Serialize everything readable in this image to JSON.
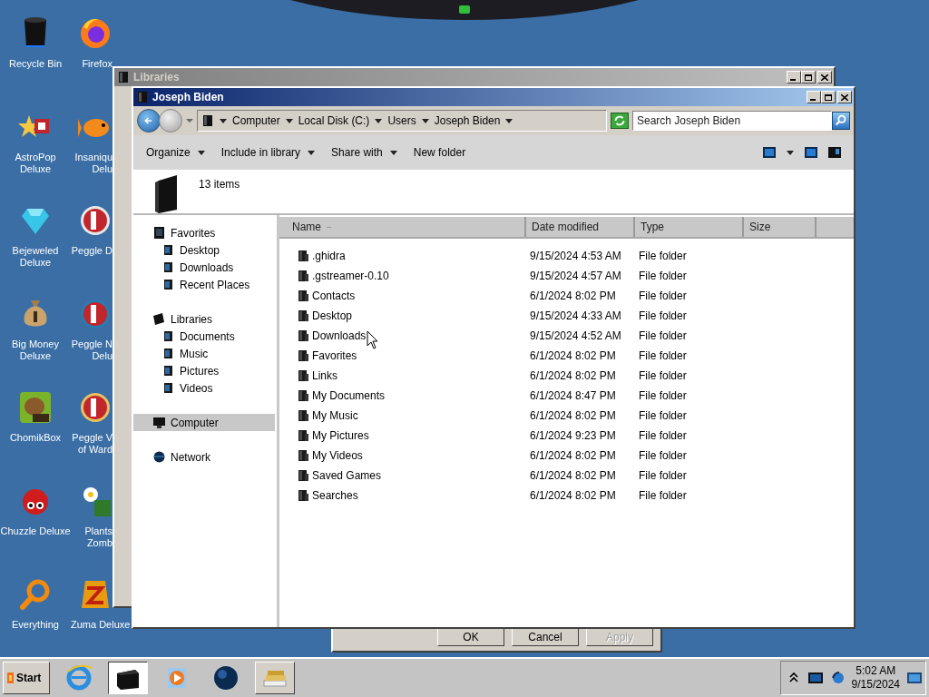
{
  "desktop_icons": [
    {
      "lines": [
        "Recycle Bin"
      ]
    },
    {
      "lines": [
        "AstroPop",
        "Deluxe"
      ]
    },
    {
      "lines": [
        "Bejeweled",
        "Deluxe"
      ]
    },
    {
      "lines": [
        "Big Money",
        "Deluxe"
      ]
    },
    {
      "lines": [
        "ChomikBox"
      ]
    },
    {
      "lines": [
        "Chuzzle Deluxe"
      ]
    },
    {
      "lines": [
        "Everything"
      ]
    },
    {
      "lines": [
        "Firefox"
      ]
    },
    {
      "lines": [
        "Insaniqu",
        "Delu"
      ]
    },
    {
      "lines": [
        "Peggle D"
      ]
    },
    {
      "lines": [
        "Peggle N",
        "Delu"
      ]
    },
    {
      "lines": [
        "Peggle V",
        "of Ward"
      ]
    },
    {
      "lines": [
        "Plants",
        "Zomb"
      ]
    },
    {
      "lines": [
        "Zuma Deluxe"
      ]
    }
  ],
  "back_window": {
    "title": "Libraries"
  },
  "back_dialog": {
    "buttons": [
      {
        "label": "OK",
        "disabled": false
      },
      {
        "label": "Cancel",
        "disabled": false
      },
      {
        "label": "Apply",
        "disabled": true
      }
    ]
  },
  "window": {
    "title": "Joseph Biden",
    "address": [
      "Computer",
      "Local Disk (C:)",
      "Users",
      "Joseph Biden"
    ],
    "search": {
      "placeholder": "Search Joseph Biden"
    },
    "toolbar": [
      {
        "label": "Organize",
        "dropdown": true
      },
      {
        "label": "Include in library",
        "dropdown": true
      },
      {
        "label": "Share with",
        "dropdown": true
      },
      {
        "label": "New folder",
        "dropdown": false
      }
    ],
    "item_count": "13 items",
    "nav_pane": [
      {
        "label": "Favorites",
        "selected": false,
        "children": [
          {
            "label": "Desktop",
            "selected": false
          },
          {
            "label": "Downloads",
            "selected": false
          },
          {
            "label": "Recent Places",
            "selected": false
          }
        ]
      },
      {
        "label": "Libraries",
        "selected": false,
        "children": [
          {
            "label": "Documents",
            "selected": false
          },
          {
            "label": "Music",
            "selected": false
          },
          {
            "label": "Pictures",
            "selected": false
          },
          {
            "label": "Videos",
            "selected": false
          }
        ]
      },
      {
        "label": "Computer",
        "selected": true
      },
      {
        "label": "Network",
        "selected": false
      }
    ],
    "table": {
      "columns": [
        "Name",
        "Date modified",
        "Type",
        "Size"
      ],
      "rows": [
        {
          "name": ".ghidra",
          "date": "9/15/2024 4:53 AM",
          "type": "File folder"
        },
        {
          "name": ".gstreamer-0.10",
          "date": "9/15/2024 4:57 AM",
          "type": "File folder"
        },
        {
          "name": "Contacts",
          "date": "6/1/2024 8:02 PM",
          "type": "File folder"
        },
        {
          "name": "Desktop",
          "date": "9/15/2024 4:33 AM",
          "type": "File folder"
        },
        {
          "name": "Downloads",
          "date": "9/15/2024 4:52 AM",
          "type": "File folder"
        },
        {
          "name": "Favorites",
          "date": "6/1/2024 8:02 PM",
          "type": "File folder"
        },
        {
          "name": "Links",
          "date": "6/1/2024 8:02 PM",
          "type": "File folder"
        },
        {
          "name": "My Documents",
          "date": "6/1/2024 8:47 PM",
          "type": "File folder"
        },
        {
          "name": "My Music",
          "date": "6/1/2024 8:02 PM",
          "type": "File folder"
        },
        {
          "name": "My Pictures",
          "date": "6/1/2024 9:23 PM",
          "type": "File folder"
        },
        {
          "name": "My Videos",
          "date": "6/1/2024 8:02 PM",
          "type": "File folder"
        },
        {
          "name": "Saved Games",
          "date": "6/1/2024 8:02 PM",
          "type": "File folder"
        },
        {
          "name": "Searches",
          "date": "6/1/2024 8:02 PM",
          "type": "File folder"
        }
      ]
    }
  },
  "taskbar": {
    "start": "Start",
    "buttons": [
      {
        "selected": false,
        "open": false
      },
      {
        "selected": true,
        "open": true
      },
      {
        "selected": false,
        "open": false
      },
      {
        "selected": false,
        "open": false
      },
      {
        "selected": false,
        "open": true
      }
    ],
    "time": "5:02 AM",
    "date": "9/15/2024"
  }
}
